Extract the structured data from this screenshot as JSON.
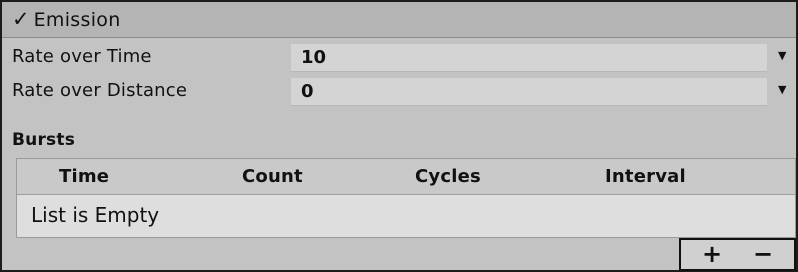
{
  "module": {
    "check": "✓",
    "title": "Emission"
  },
  "fields": [
    {
      "label": "Rate over Time",
      "value": "10"
    },
    {
      "label": "Rate over Distance",
      "value": "0"
    }
  ],
  "bursts": {
    "label": "Bursts",
    "columns": [
      "Time",
      "Count",
      "Cycles",
      "Interval"
    ],
    "empty_text": "List is Empty"
  },
  "buttons": {
    "add": "+",
    "remove": "−"
  },
  "icons": {
    "dropdown": "dropdown-arrow-icon",
    "check": "check-icon"
  }
}
